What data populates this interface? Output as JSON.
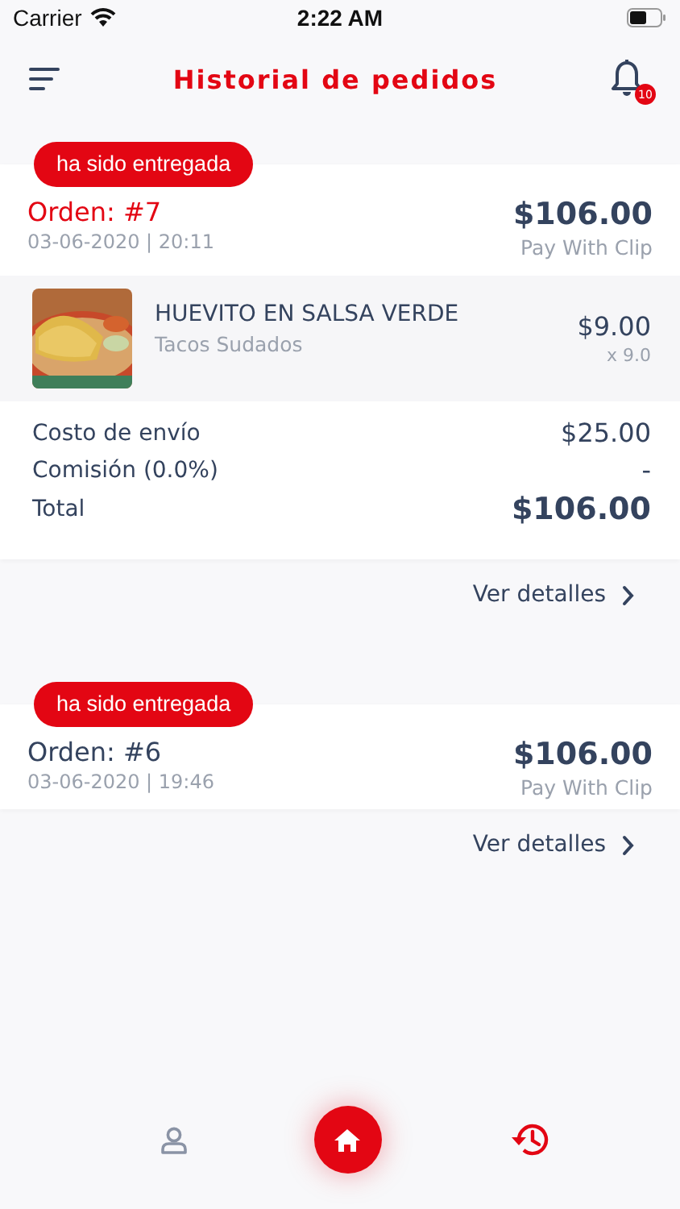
{
  "status_bar": {
    "carrier": "Carrier",
    "time": "2:22 AM"
  },
  "header": {
    "title": "Historial de pedidos",
    "notification_count": "10"
  },
  "orders": [
    {
      "status": "ha sido entregada",
      "number": "Orden: #7",
      "highlighted": true,
      "date": "03-06-2020 | 20:11",
      "total": "$106.00",
      "payment": "Pay With Clip",
      "items": [
        {
          "name": "HUEVITO EN SALSA VERDE",
          "store": "Tacos Sudados",
          "price": "$9.00",
          "quantity": "x 9.0"
        }
      ],
      "summary": [
        {
          "label": "Costo de envío",
          "value": "$25.00",
          "kind": "line"
        },
        {
          "label": "Comisión (0.0%)",
          "value": "-",
          "kind": "line"
        },
        {
          "label": "Total",
          "value": "$106.00",
          "kind": "total"
        }
      ],
      "details_link": "Ver detalles"
    },
    {
      "status": "ha sido entregada",
      "number": "Orden: #6",
      "highlighted": false,
      "date": "03-06-2020 | 19:46",
      "total": "$106.00",
      "payment": "Pay With Clip",
      "details_link": "Ver detalles"
    }
  ],
  "bottom_nav": [
    {
      "kind": "profile",
      "selected": false
    },
    {
      "kind": "home"
    },
    {
      "kind": "history",
      "selected": true
    }
  ]
}
